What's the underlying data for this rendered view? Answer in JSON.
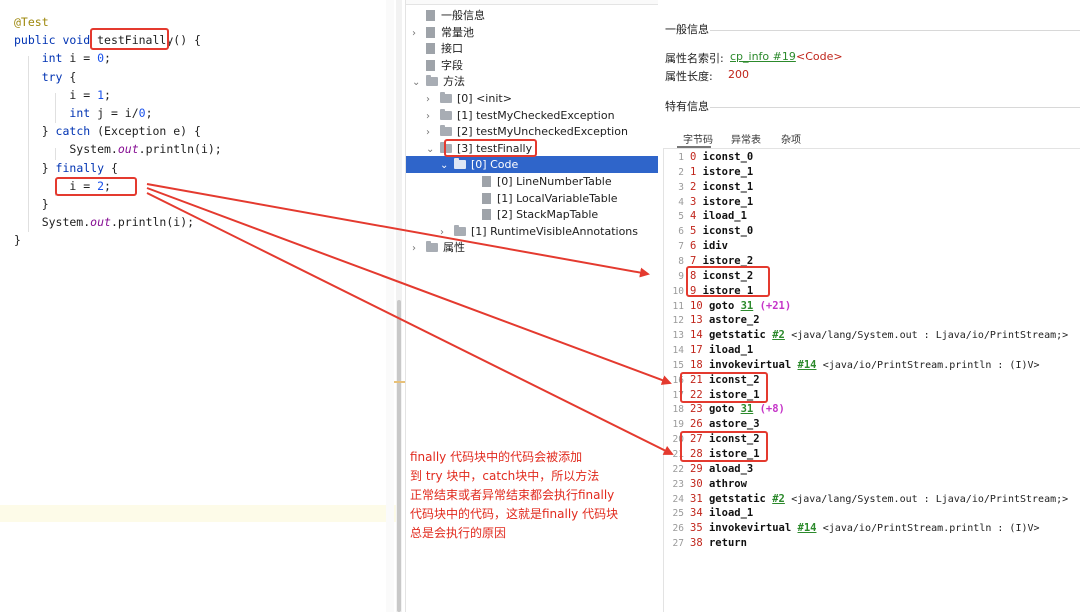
{
  "editor": {
    "lines": [
      {
        "parts": [
          {
            "t": "@Test",
            "c": "anno"
          }
        ]
      },
      {
        "parts": [
          {
            "t": "public void ",
            "c": "kw"
          },
          {
            "t": "testFinally",
            "c": ""
          },
          {
            "t": "() {",
            "c": ""
          }
        ]
      },
      {
        "parts": [
          {
            "t": "    ",
            "c": ""
          },
          {
            "t": "int ",
            "c": "kw"
          },
          {
            "t": "i = ",
            "c": ""
          },
          {
            "t": "0",
            "c": "num"
          },
          {
            "t": ";",
            "c": ""
          }
        ]
      },
      {
        "parts": [
          {
            "t": "    ",
            "c": ""
          },
          {
            "t": "try",
            "c": "kw"
          },
          {
            "t": " {",
            "c": ""
          }
        ]
      },
      {
        "parts": [
          {
            "t": "        i = ",
            "c": ""
          },
          {
            "t": "1",
            "c": "num"
          },
          {
            "t": ";",
            "c": ""
          }
        ]
      },
      {
        "parts": [
          {
            "t": "        ",
            "c": ""
          },
          {
            "t": "int ",
            "c": "kw"
          },
          {
            "t": "j = i/",
            "c": ""
          },
          {
            "t": "0",
            "c": "num"
          },
          {
            "t": ";",
            "c": ""
          }
        ]
      },
      {
        "parts": [
          {
            "t": "    } ",
            "c": ""
          },
          {
            "t": "catch",
            "c": "kw"
          },
          {
            "t": " (Exception e) {",
            "c": ""
          }
        ]
      },
      {
        "parts": [
          {
            "t": "        System.",
            "c": ""
          },
          {
            "t": "out",
            "c": "fld"
          },
          {
            "t": ".println(i);",
            "c": ""
          }
        ]
      },
      {
        "parts": [
          {
            "t": "    } ",
            "c": ""
          },
          {
            "t": "finally",
            "c": "kw"
          },
          {
            "t": " {",
            "c": ""
          }
        ]
      },
      {
        "parts": [
          {
            "t": "        i = ",
            "c": ""
          },
          {
            "t": "2",
            "c": "num"
          },
          {
            "t": ";",
            "c": ""
          }
        ]
      },
      {
        "parts": [
          {
            "t": "    }",
            "c": ""
          }
        ]
      },
      {
        "parts": [
          {
            "t": "    System.",
            "c": ""
          },
          {
            "t": "out",
            "c": "fld"
          },
          {
            "t": ".println(i);",
            "c": ""
          }
        ]
      },
      {
        "parts": [
          {
            "t": "}",
            "c": ""
          }
        ]
      }
    ]
  },
  "tree": {
    "nodes": [
      {
        "label": "一般信息",
        "arrow": "",
        "icon": "file-icon"
      },
      {
        "label": "常量池",
        "arrow": "›",
        "icon": "file-icon"
      },
      {
        "label": "接口",
        "arrow": "",
        "icon": "file-icon"
      },
      {
        "label": "字段",
        "arrow": "",
        "icon": "file-icon"
      },
      {
        "label": "方法",
        "arrow": "⌄",
        "icon": "folder-icon"
      },
      {
        "label": "[0] <init>",
        "arrow": "›",
        "icon": "folder-icon"
      },
      {
        "label": "[1] testMyCheckedException",
        "arrow": "›",
        "icon": "folder-icon"
      },
      {
        "label": "[2] testMyUncheckedException",
        "arrow": "›",
        "icon": "folder-icon"
      },
      {
        "label": "[3] testFinally",
        "arrow": "⌄",
        "icon": "folder-icon"
      },
      {
        "label": "[0] Code",
        "arrow": "⌄",
        "icon": "folder-icon"
      },
      {
        "label": "[0] LineNumberTable",
        "arrow": "",
        "icon": "file-icon"
      },
      {
        "label": "[1] LocalVariableTable",
        "arrow": "",
        "icon": "file-icon"
      },
      {
        "label": "[2] StackMapTable",
        "arrow": "",
        "icon": "file-icon"
      },
      {
        "label": "[1] RuntimeVisibleAnnotations",
        "arrow": "›",
        "icon": "folder-icon"
      },
      {
        "label": "属性",
        "arrow": "›",
        "icon": "folder-icon"
      }
    ]
  },
  "detail": {
    "general_title": "一般信息",
    "attr_name_label": "属性名索引:",
    "attr_name_link": "cp_info #19",
    "attr_name_value": "<Code>",
    "attr_len_label": "属性长度:",
    "attr_len_value": "200",
    "specific_title": "特有信息",
    "tabs": [
      "字节码",
      "异常表",
      "杂项"
    ]
  },
  "bytecode": [
    {
      "ln": "1",
      "off": "0",
      "op": "iconst_0"
    },
    {
      "ln": "2",
      "off": "1",
      "op": "istore_1"
    },
    {
      "ln": "3",
      "off": "2",
      "op": "iconst_1"
    },
    {
      "ln": "4",
      "off": "3",
      "op": "istore_1"
    },
    {
      "ln": "5",
      "off": "4",
      "op": "iload_1"
    },
    {
      "ln": "6",
      "off": "5",
      "op": "iconst_0"
    },
    {
      "ln": "7",
      "off": "6",
      "op": "idiv"
    },
    {
      "ln": "8",
      "off": "7",
      "op": "istore_2"
    },
    {
      "ln": "9",
      "off": "8",
      "op": "iconst_2"
    },
    {
      "ln": "10",
      "off": "9",
      "op": "istore_1"
    },
    {
      "ln": "11",
      "off": "10",
      "op": "goto",
      "ref": "31",
      "rel": "(+21)"
    },
    {
      "ln": "12",
      "off": "13",
      "op": "astore_2"
    },
    {
      "ln": "13",
      "off": "14",
      "op": "getstatic",
      "ref": "#2",
      "cmt": "<java/lang/System.out : Ljava/io/PrintStream;>"
    },
    {
      "ln": "14",
      "off": "17",
      "op": "iload_1"
    },
    {
      "ln": "15",
      "off": "18",
      "op": "invokevirtual",
      "ref": "#14",
      "cmt": "<java/io/PrintStream.println : (I)V>"
    },
    {
      "ln": "16",
      "off": "21",
      "op": "iconst_2"
    },
    {
      "ln": "17",
      "off": "22",
      "op": "istore_1"
    },
    {
      "ln": "18",
      "off": "23",
      "op": "goto",
      "ref": "31",
      "rel": "(+8)"
    },
    {
      "ln": "19",
      "off": "26",
      "op": "astore_3"
    },
    {
      "ln": "20",
      "off": "27",
      "op": "iconst_2"
    },
    {
      "ln": "21",
      "off": "28",
      "op": "istore_1"
    },
    {
      "ln": "22",
      "off": "29",
      "op": "aload_3"
    },
    {
      "ln": "23",
      "off": "30",
      "op": "athrow"
    },
    {
      "ln": "24",
      "off": "31",
      "op": "getstatic",
      "ref": "#2",
      "cmt": "<java/lang/System.out : Ljava/io/PrintStream;>"
    },
    {
      "ln": "25",
      "off": "34",
      "op": "iload_1"
    },
    {
      "ln": "26",
      "off": "35",
      "op": "invokevirtual",
      "ref": "#14",
      "cmt": "<java/io/PrintStream.println : (I)V>"
    },
    {
      "ln": "27",
      "off": "38",
      "op": "return"
    }
  ],
  "note": {
    "lines": [
      "finally 代码块中的代码会被添加",
      "到 try 块中，catch块中，所以方法",
      "正常结束或者异常结束都会执行finally",
      "代码块中的代码，这就是finally 代码块",
      "总是会执行的原因"
    ]
  },
  "colors": {
    "annotation_red": "#e43a2f",
    "selection_blue": "#2f65ca",
    "link_green": "#2c8a2c",
    "offset_red": "#c0251b"
  }
}
